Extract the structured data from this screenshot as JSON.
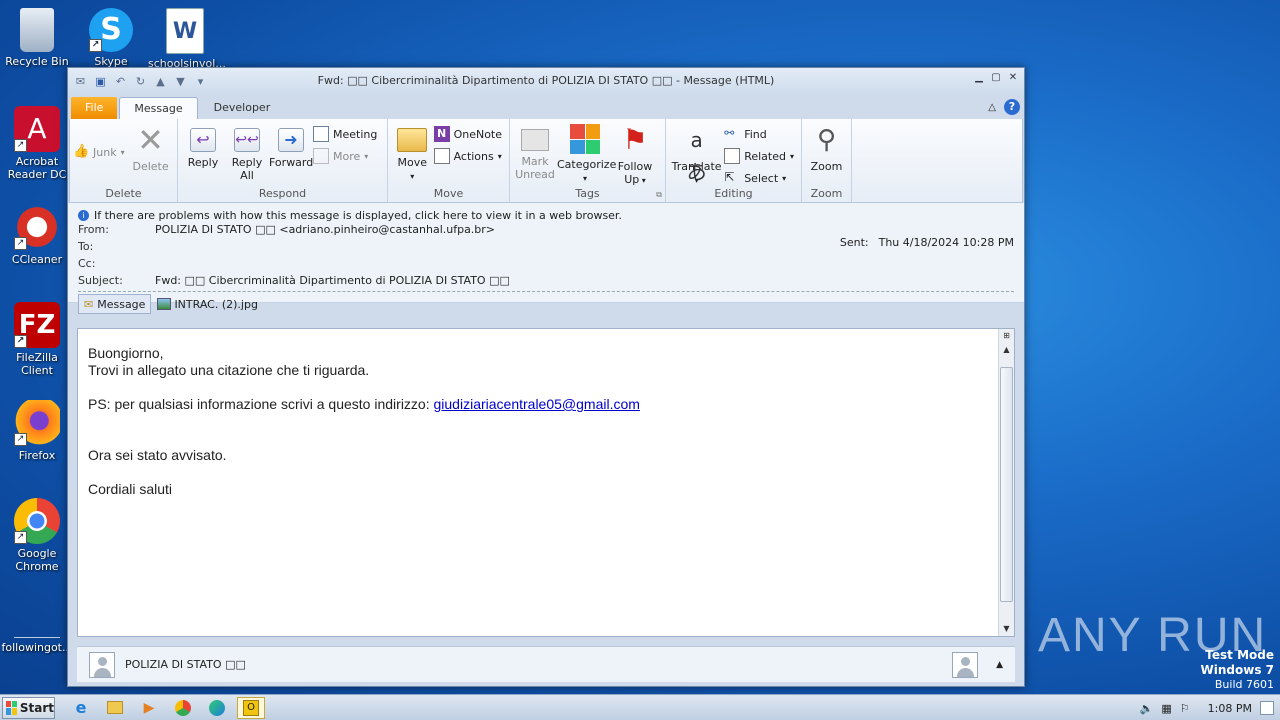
{
  "desktop": {
    "icons": [
      {
        "label": "Recycle Bin"
      },
      {
        "label": "Skype"
      },
      {
        "label": "schoolsinvol..."
      },
      {
        "label": "Acrobat Reader DC"
      },
      {
        "label": "CCleaner"
      },
      {
        "label": "FileZilla Client"
      },
      {
        "label": "Firefox"
      },
      {
        "label": "Google Chrome"
      },
      {
        "label": "followingot..."
      }
    ],
    "watermark": "ANY RUN",
    "test_mode": {
      "line1": "Test Mode",
      "line2": "Windows 7",
      "line3": "Build 7601"
    }
  },
  "window": {
    "title": "Fwd: □□ Cibercriminalità Dipartimento di POLIZIA DI STATO □□ - Message (HTML)",
    "tabs": {
      "file": "File",
      "message": "Message",
      "developer": "Developer"
    },
    "ribbon": {
      "delete_group": {
        "label": "Delete",
        "junk": "Junk",
        "delete": "Delete"
      },
      "respond_group": {
        "label": "Respond",
        "reply": "Reply",
        "reply_all_1": "Reply",
        "reply_all_2": "All",
        "forward": "Forward",
        "meeting": "Meeting",
        "more": "More"
      },
      "move_group": {
        "label": "Move",
        "move": "Move",
        "onenote": "OneNote",
        "actions": "Actions"
      },
      "tags_group": {
        "label": "Tags",
        "mark_unread_1": "Mark",
        "mark_unread_2": "Unread",
        "categorize": "Categorize",
        "follow_up_1": "Follow",
        "follow_up_2": "Up"
      },
      "editing_group": {
        "label": "Editing",
        "translate": "Translate",
        "find": "Find",
        "related": "Related",
        "select": "Select"
      },
      "zoom_group": {
        "label": "Zoom",
        "zoom": "Zoom"
      }
    },
    "message": {
      "infobar": "If there are problems with how this message is displayed, click here to view it in a web browser.",
      "from_label": "From:",
      "from_value": "POLIZIA DI STATO □□ <adriano.pinheiro@castanhal.ufpa.br>",
      "to_label": "To:",
      "cc_label": "Cc:",
      "subject_label": "Subject:",
      "subject_value": "Fwd: □□ Cibercriminalità Dipartimento di POLIZIA DI STATO □□",
      "sent_label": "Sent:",
      "sent_value": "Thu 4/18/2024 10:28 PM",
      "attachments": {
        "message_tab": "Message",
        "file": "INTRAC. (2).jpg"
      },
      "body": {
        "line1": "Buongiorno,",
        "line2": "Trovi in allegato una citazione che ti riguarda.",
        "ps_text": "PS: per qualsiasi informazione scrivi a questo indirizzo: ",
        "ps_link": "giudiziariacentrale05@gmail.com",
        "line4": "Ora sei stato avvisato.",
        "line5": "Cordiali saluti"
      },
      "people_pane": "POLIZIA DI STATO □□"
    }
  },
  "taskbar": {
    "start": "Start",
    "time": "1:08 PM"
  }
}
